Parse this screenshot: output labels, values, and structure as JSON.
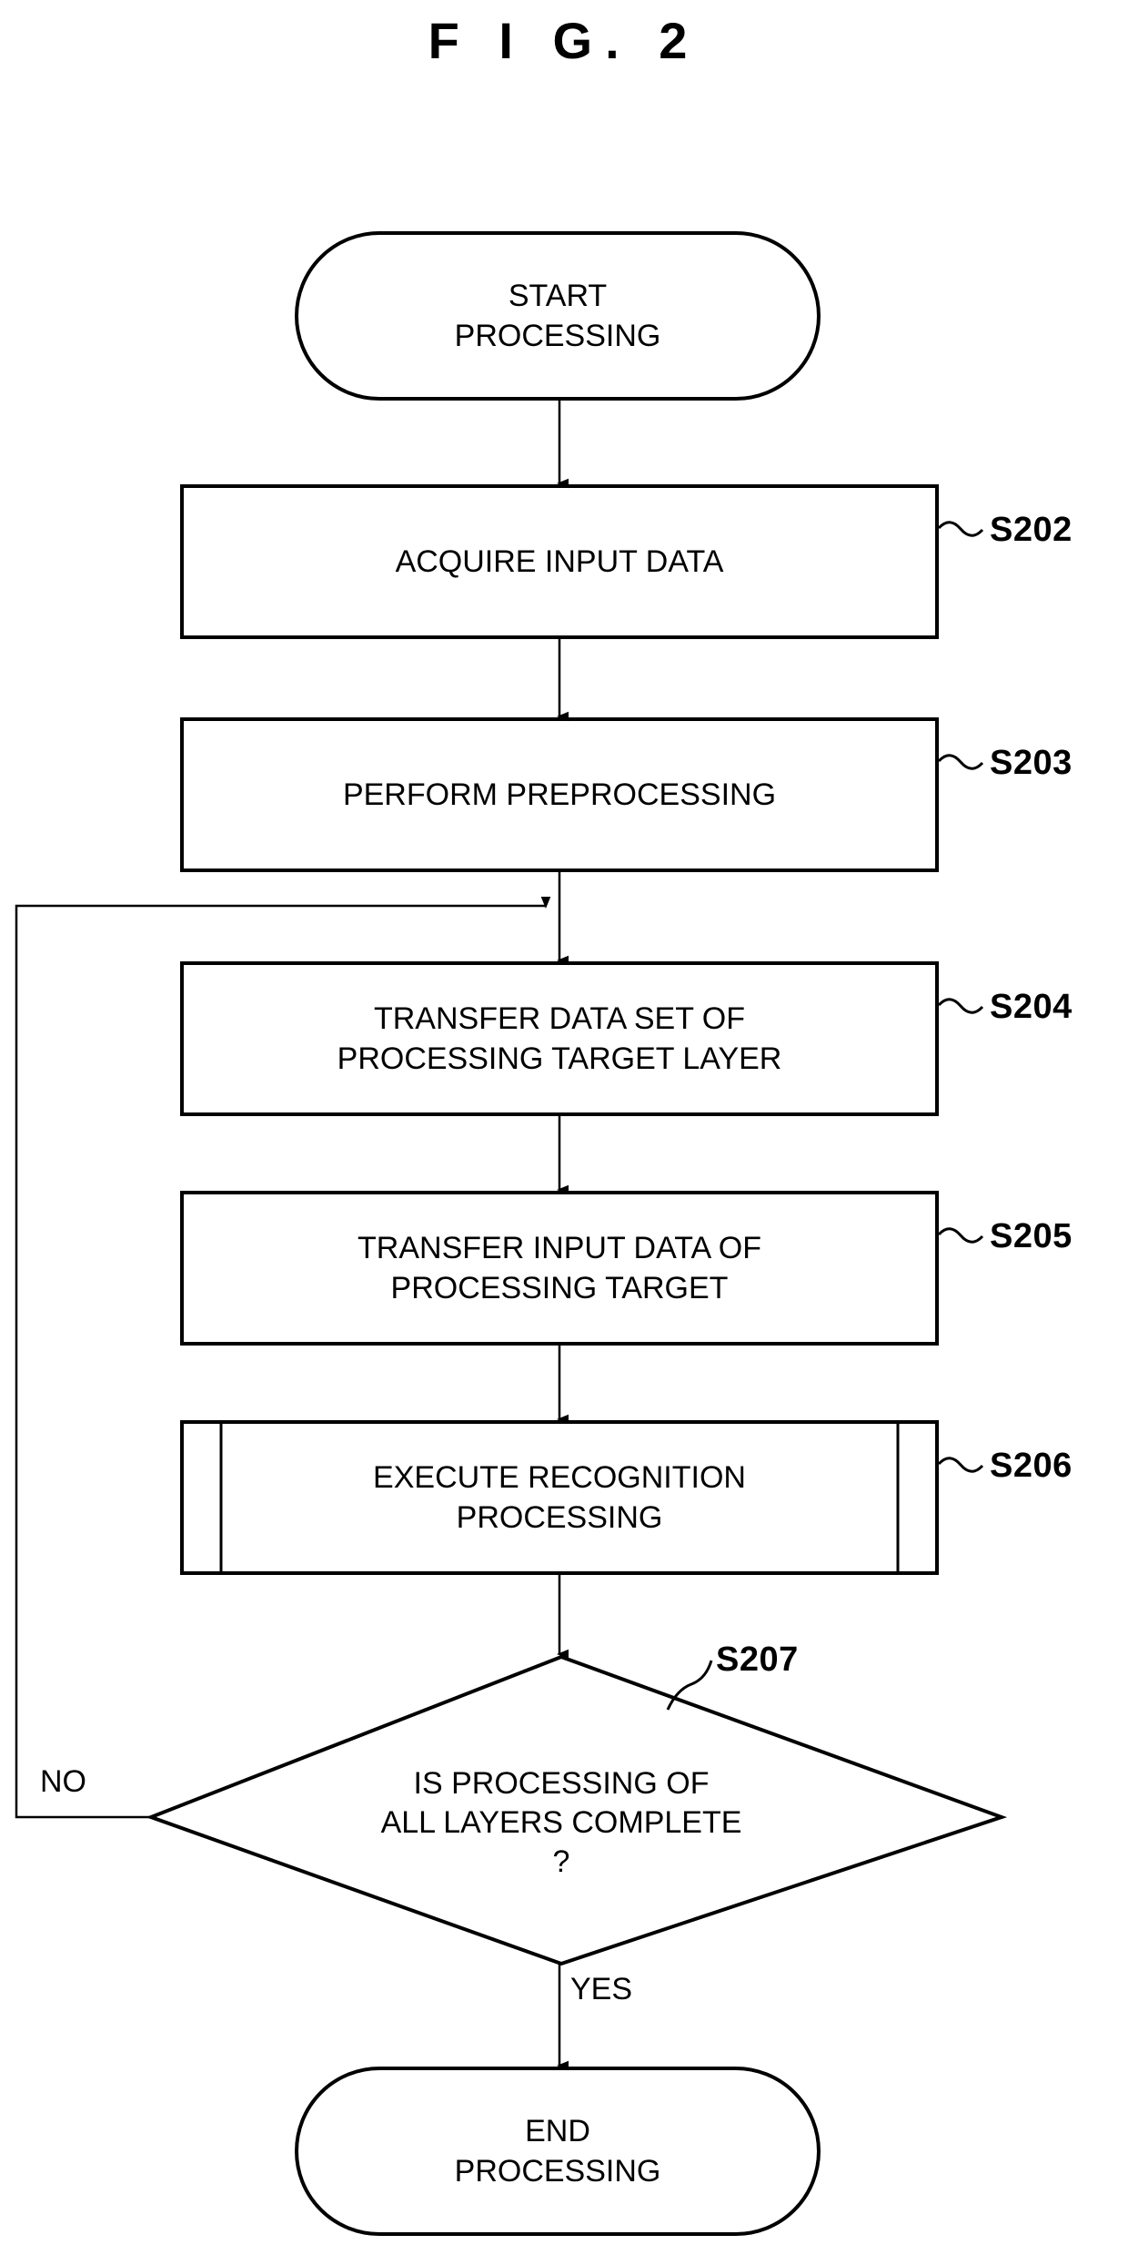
{
  "figure": {
    "title": "F I G.  2"
  },
  "nodes": [
    {
      "id": "start",
      "shape": "terminator",
      "text": "START\nPROCESSING"
    },
    {
      "id": "s202",
      "shape": "process",
      "text": "ACQUIRE INPUT DATA",
      "tag": "S202"
    },
    {
      "id": "s203",
      "shape": "process",
      "text": "PERFORM PREPROCESSING",
      "tag": "S203"
    },
    {
      "id": "s204",
      "shape": "process",
      "text": "TRANSFER DATA SET OF\nPROCESSING TARGET LAYER",
      "tag": "S204"
    },
    {
      "id": "s205",
      "shape": "process",
      "text": "TRANSFER INPUT DATA OF\nPROCESSING TARGET",
      "tag": "S205"
    },
    {
      "id": "s206",
      "shape": "predefined-process",
      "text": "EXECUTE RECOGNITION\nPROCESSING",
      "tag": "S206"
    },
    {
      "id": "s207",
      "shape": "decision",
      "text": "IS PROCESSING OF\nALL LAYERS COMPLETE\n?",
      "tag": "S207"
    },
    {
      "id": "end",
      "shape": "terminator",
      "text": "END\nPROCESSING"
    }
  ],
  "branches": {
    "no_label": "NO",
    "yes_label": "YES"
  },
  "colors": {
    "stroke": "#000000",
    "fill": "#ffffff",
    "text": "#000000"
  }
}
